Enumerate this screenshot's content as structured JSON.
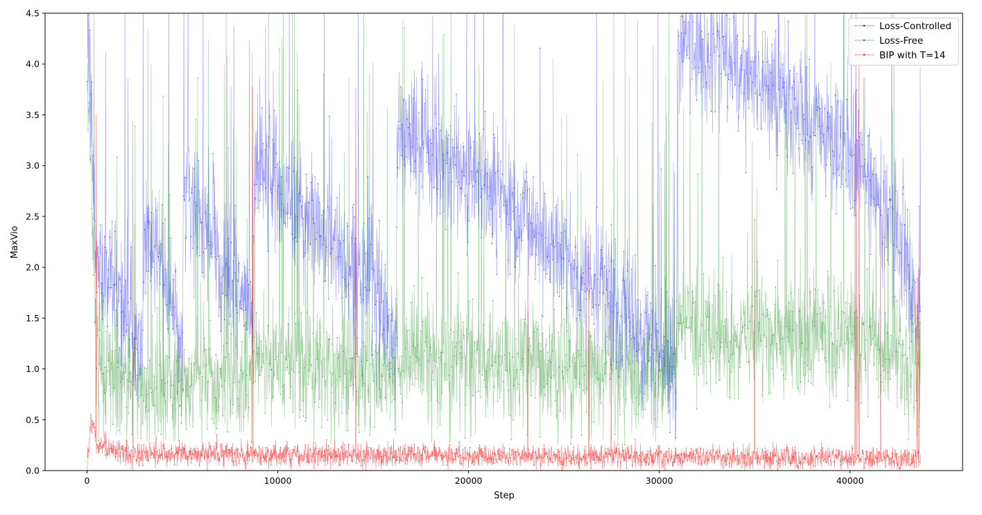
{
  "chart_data": {
    "type": "line",
    "xlabel": "Step",
    "ylabel": "MaxVio",
    "xlim": [
      -2200,
      45900
    ],
    "ylim": [
      0,
      4.5
    ],
    "x_ticks": [
      0,
      10000,
      20000,
      30000,
      40000
    ],
    "x_tick_labels": [
      "0",
      "10000",
      "20000",
      "30000",
      "40000"
    ],
    "y_ticks": [
      0,
      0.5,
      1.0,
      1.5,
      2.0,
      2.5,
      3.0,
      3.5,
      4.0,
      4.5
    ],
    "y_tick_labels": [
      "0.0",
      "0.5",
      "1.0",
      "1.5",
      "2.0",
      "2.5",
      "3.0",
      "3.5",
      "4.0",
      "4.5"
    ],
    "grid": false,
    "legend_position": "top-right",
    "x_max_step": 43700,
    "series": [
      {
        "name": "Loss-Controlled",
        "color": "#0000ff",
        "marker": "point",
        "trend": [
          [
            0,
            4.6
          ],
          [
            300,
            3.0
          ],
          [
            500,
            2.0
          ],
          [
            1500,
            1.9
          ],
          [
            2500,
            1.3
          ],
          [
            2900,
            1.0
          ],
          [
            3000,
            2.4
          ],
          [
            4000,
            2.1
          ],
          [
            5000,
            1.2
          ],
          [
            5050,
            2.7
          ],
          [
            6000,
            2.5
          ],
          [
            7000,
            2.1
          ],
          [
            8000,
            1.75
          ],
          [
            8700,
            1.4
          ],
          [
            8750,
            3.0
          ],
          [
            9500,
            2.9
          ],
          [
            11000,
            2.6
          ],
          [
            13000,
            2.2
          ],
          [
            15000,
            1.8
          ],
          [
            16200,
            1.2
          ],
          [
            16250,
            3.3
          ],
          [
            17000,
            3.3
          ],
          [
            19000,
            3.0
          ],
          [
            21000,
            2.85
          ],
          [
            23000,
            2.5
          ],
          [
            25000,
            2.1
          ],
          [
            27000,
            1.75
          ],
          [
            29000,
            1.4
          ],
          [
            30900,
            1.0
          ],
          [
            30950,
            4.2
          ],
          [
            32000,
            4.15
          ],
          [
            34000,
            4.0
          ],
          [
            36000,
            3.75
          ],
          [
            38000,
            3.4
          ],
          [
            40000,
            3.1
          ],
          [
            42000,
            2.6
          ],
          [
            43000,
            2.1
          ],
          [
            43700,
            1.5
          ]
        ]
      },
      {
        "name": "Loss-Free",
        "color": "#008000",
        "marker": "point",
        "trend": [
          [
            0,
            3.8
          ],
          [
            200,
            3.0
          ],
          [
            500,
            1.2
          ],
          [
            1500,
            0.85
          ],
          [
            4000,
            0.8
          ],
          [
            5000,
            0.8
          ],
          [
            5050,
            0.9
          ],
          [
            8700,
            0.85
          ],
          [
            8750,
            1.1
          ],
          [
            16200,
            0.95
          ],
          [
            16250,
            1.15
          ],
          [
            30900,
            0.9
          ],
          [
            30950,
            1.35
          ],
          [
            40000,
            1.3
          ],
          [
            43700,
            1.0
          ]
        ]
      },
      {
        "name": "BIP with T=14",
        "color": "#ff0000",
        "marker": "point",
        "trend": [
          [
            0,
            0.05
          ],
          [
            250,
            0.55
          ],
          [
            500,
            0.25
          ],
          [
            2000,
            0.17
          ],
          [
            10000,
            0.16
          ],
          [
            20000,
            0.14
          ],
          [
            30000,
            0.13
          ],
          [
            43700,
            0.12
          ]
        ]
      }
    ]
  }
}
